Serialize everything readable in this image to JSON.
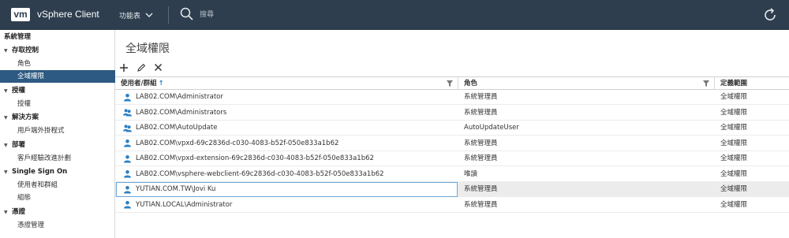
{
  "header": {
    "logo": "vm",
    "app_title": "vSphere Client",
    "menu_label": "功能表",
    "search_placeholder": "搜尋"
  },
  "sidebar": {
    "root": "系統管理",
    "groups": [
      {
        "label": "存取控制",
        "items": [
          "角色",
          "全域權限"
        ]
      },
      {
        "label": "授權",
        "items": [
          "授權"
        ]
      },
      {
        "label": "解決方案",
        "items": [
          "用戶端外掛程式"
        ]
      },
      {
        "label": "部署",
        "items": [
          "客戶經驗改進計劃"
        ]
      },
      {
        "label": "Single Sign On",
        "items": [
          "使用者和群組",
          "組態"
        ]
      },
      {
        "label": "憑證",
        "items": [
          "憑證管理"
        ]
      }
    ],
    "selected": "全域權限"
  },
  "main": {
    "title": "全域權限",
    "columns": [
      "使用者/群組",
      "角色",
      "定義範圍"
    ],
    "sort_indicator": "↑",
    "rows": [
      {
        "user": "LAB02.COM\\Administrator",
        "type": "user",
        "role": "系統管理員",
        "scope": "全域權限"
      },
      {
        "user": "LAB02.COM\\Administrators",
        "type": "group",
        "role": "系統管理員",
        "scope": "全域權限"
      },
      {
        "user": "LAB02.COM\\AutoUpdate",
        "type": "group",
        "role": "AutoUpdateUser",
        "scope": "全域權限"
      },
      {
        "user": "LAB02.COM\\vpxd-69c2836d-c030-4083-b52f-050e833a1b62",
        "type": "user",
        "role": "系統管理員",
        "scope": "全域權限"
      },
      {
        "user": "LAB02.COM\\vpxd-extension-69c2836d-c030-4083-b52f-050e833a1b62",
        "type": "user",
        "role": "系統管理員",
        "scope": "全域權限"
      },
      {
        "user": "LAB02.COM\\vsphere-webclient-69c2836d-c030-4083-b52f-050e833a1b62",
        "type": "user",
        "role": "唯讀",
        "scope": "全域權限"
      },
      {
        "user": "YUTIAN.COM.TW\\Jovi Ku",
        "type": "user",
        "role": "系統管理員",
        "scope": "全域權限",
        "selected": true
      },
      {
        "user": "YUTIAN.LOCAL\\Administrator",
        "type": "user",
        "role": "系統管理員",
        "scope": "全域權限"
      }
    ]
  },
  "colors": {
    "header_bg": "#2e3e4e",
    "selected_nav": "#2c5a82",
    "icon_blue": "#2b7fc4"
  }
}
